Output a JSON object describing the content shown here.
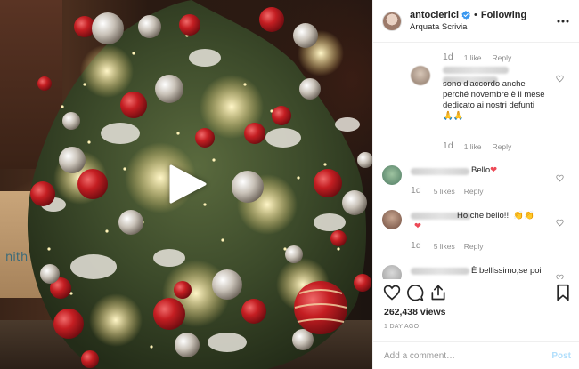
{
  "header": {
    "username": "antoclerici",
    "follow_label": "Following",
    "separator": "•",
    "location": "Arquata Scrivia"
  },
  "comments": [
    {
      "time": "1d",
      "likes": "1 like",
      "reply": "Reply"
    },
    {
      "text": "sono d'accordo anche perché novembre è il mese dedicato ai nostri defunti",
      "emoji": "🙏🙏",
      "time": "1d",
      "likes": "1 like",
      "reply": "Reply"
    },
    {
      "text": "Bello",
      "emoji": "❤",
      "time": "1d",
      "likes": "5 likes",
      "reply": "Reply"
    },
    {
      "text": "Ho che bello!!!",
      "emoji": "👏👏",
      "emoji2": "❤",
      "time": "1d",
      "likes": "5 likes",
      "reply": "Reply"
    },
    {
      "text": "È bellissimo,se poi"
    }
  ],
  "post": {
    "views": "262,438 views",
    "date": "1 DAY AGO"
  },
  "add_comment": {
    "placeholder": "Add a comment…",
    "post_label": "Post"
  },
  "media": {
    "box_text": "nith"
  },
  "icons": {
    "verified": "verified-badge-icon",
    "more": "more-options-icon",
    "like": "heart-icon",
    "comment": "comment-icon",
    "share": "share-icon",
    "save": "bookmark-icon",
    "play": "play-icon"
  },
  "colors": {
    "verified": "#3897f0",
    "post_disabled": "#b2dffc",
    "heart_red": "#ed4956",
    "muted": "#8e8e8e"
  }
}
